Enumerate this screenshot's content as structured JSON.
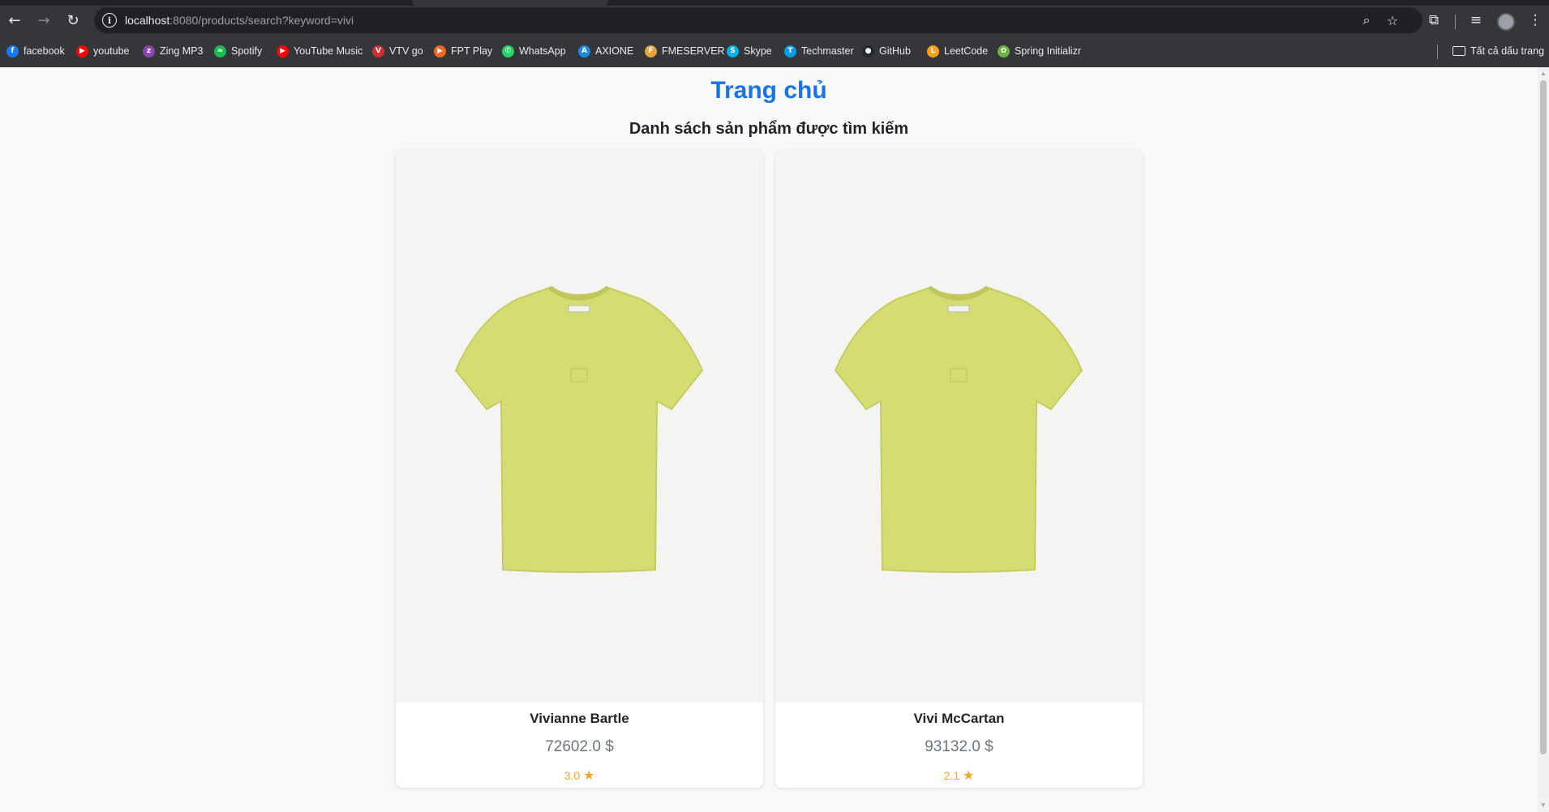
{
  "browser": {
    "url_host": "localhost",
    "url_rest": ":8080/products/search?keyword=vivi",
    "bookmarks": [
      {
        "label": "facebook",
        "color": "#1877f2",
        "glyph": "f"
      },
      {
        "label": "youtube",
        "color": "#ff0000",
        "glyph": "▶"
      },
      {
        "label": "Zing MP3",
        "color": "#8e44ad",
        "glyph": "z"
      },
      {
        "label": "Spotify",
        "color": "#1db954",
        "glyph": "≈"
      },
      {
        "label": "YouTube Music",
        "color": "#ff0000",
        "glyph": "▶"
      },
      {
        "label": "VTV go",
        "color": "#d32f2f",
        "glyph": "V"
      },
      {
        "label": "FPT Play",
        "color": "#f26522",
        "glyph": "▶"
      },
      {
        "label": "WhatsApp",
        "color": "#25d366",
        "glyph": "✆"
      },
      {
        "label": "AXIONE",
        "color": "#1e88e5",
        "glyph": "A"
      },
      {
        "label": "FMESERVER",
        "color": "#e8a33d",
        "glyph": "F"
      },
      {
        "label": "Skype",
        "color": "#00aff0",
        "glyph": "S"
      },
      {
        "label": "Techmaster",
        "color": "#039be5",
        "glyph": "T"
      },
      {
        "label": "GitHub",
        "color": "#24292e",
        "glyph": "●"
      },
      {
        "label": "LeetCode",
        "color": "#ffa116",
        "glyph": "L"
      },
      {
        "label": "Spring Initializr",
        "color": "#6db33f",
        "glyph": "✿"
      }
    ],
    "all_bookmarks_label": "Tất cả dấu trang"
  },
  "page": {
    "home_link": "Trang chủ",
    "subtitle": "Danh sách sản phẩm được tìm kiếm",
    "products": [
      {
        "name": "Vivianne Bartle",
        "price": "72602.0",
        "currency": "$",
        "rating": "3.0",
        "image": "lime-green-t-shirt"
      },
      {
        "name": "Vivi McCartan",
        "price": "93132.0",
        "currency": "$",
        "rating": "2.1",
        "image": "lime-green-t-shirt"
      }
    ]
  },
  "colors": {
    "accent": "#1a73e8",
    "shirt": "#d4dc72",
    "rating": "#f5a623"
  }
}
